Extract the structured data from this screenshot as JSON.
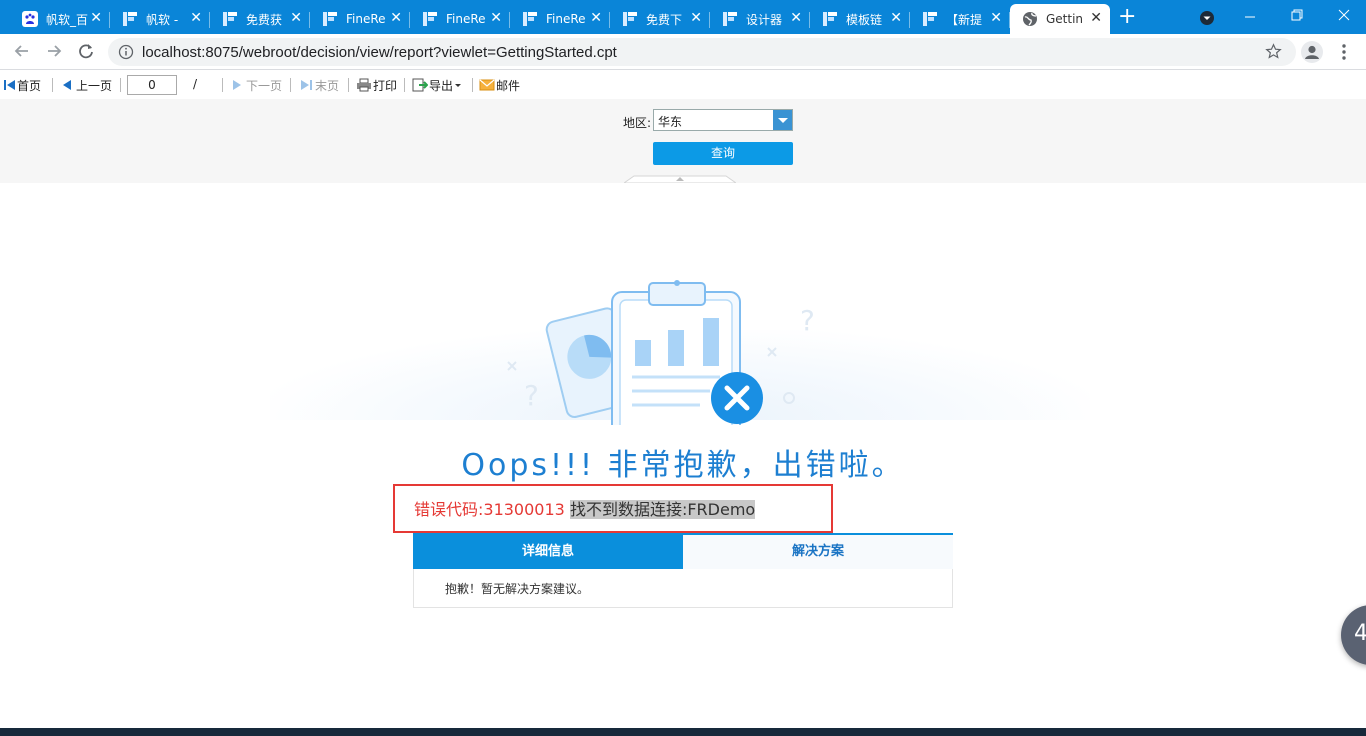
{
  "browser": {
    "tabs": [
      {
        "label": "帆软_百",
        "icon": "baidu-icon"
      },
      {
        "label": "帆软 -",
        "icon": "finereport-icon"
      },
      {
        "label": "免费获",
        "icon": "finereport-icon"
      },
      {
        "label": "FineRe",
        "icon": "finereport-icon"
      },
      {
        "label": "FineRe",
        "icon": "finereport-icon"
      },
      {
        "label": "FineRe",
        "icon": "finereport-icon"
      },
      {
        "label": "免费下",
        "icon": "finereport-icon"
      },
      {
        "label": "设计器",
        "icon": "finereport-icon"
      },
      {
        "label": "模板链",
        "icon": "finereport-icon"
      },
      {
        "label": "【新提",
        "icon": "finereport-icon"
      },
      {
        "label": "Gettin",
        "icon": "globe-icon",
        "active": true
      }
    ],
    "close_glyph": "✕",
    "new_tab_glyph": "+",
    "url": "localhost:8075/webroot/decision/view/report?viewlet=GettingStarted.cpt"
  },
  "report_toolbar": {
    "first_page": "首页",
    "prev_page": "上一页",
    "page_value": "0",
    "page_separator": "/",
    "next_page": "下一页",
    "last_page": "末页",
    "print": "打印",
    "export": "导出",
    "email": "邮件"
  },
  "params": {
    "region_label": "地区:",
    "region_value": "华东",
    "query_button": "查询"
  },
  "error": {
    "headline": "Oops!!! 非常抱歉，出错啦。",
    "code_text": "错误代码:31300013",
    "message_text": "找不到数据连接:FRDemo",
    "tab_details": "详细信息",
    "tab_solution": "解决方案",
    "detail_text": "抱歉！暂无解决方案建议。"
  },
  "float_bubble_text": "4",
  "colors": {
    "tabstrip": "#0a85d8",
    "accent": "#0a8fdc",
    "error_red": "#e53935",
    "headline_blue": "#1d7fd1"
  }
}
